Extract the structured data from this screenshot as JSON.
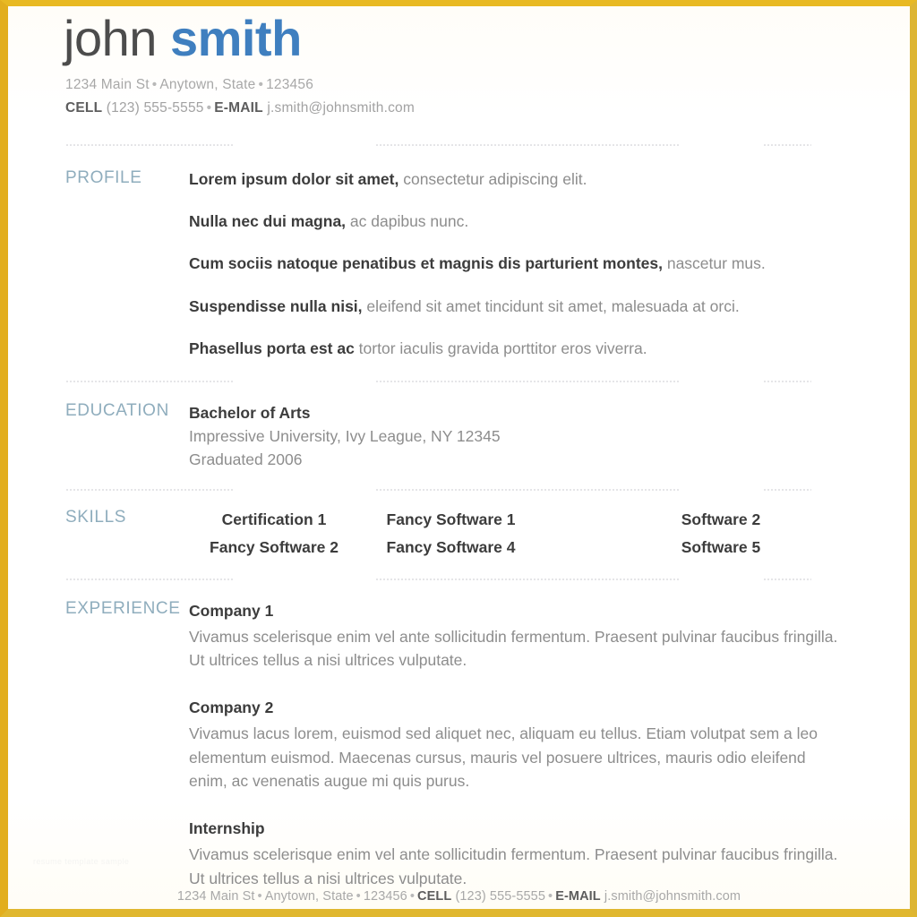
{
  "colors": {
    "accent_blue": "#3f7fbf",
    "section_label": "#8fadbd",
    "body_text": "#8d8d8d",
    "strong_text": "#3c3c3c",
    "page_border_gold": "#e8b923"
  },
  "header": {
    "first_name": "john",
    "last_name": "smith",
    "address": "1234 Main St",
    "city_state": "Anytown, State",
    "zip": "123456",
    "cell_label": "CELL",
    "cell_value": "(123) 555-5555",
    "email_label": "E-MAIL",
    "email_value": "j.smith@johnsmith.com",
    "separator": "•"
  },
  "sections": {
    "profile": {
      "label": "PROFILE",
      "items": [
        {
          "lead": "Lorem ipsum dolor sit amet,",
          "rest": " consectetur adipiscing elit."
        },
        {
          "lead": "Nulla nec dui magna,",
          "rest": " ac dapibus nunc."
        },
        {
          "lead": "Cum sociis natoque penatibus et magnis dis parturient montes,",
          "rest": " nascetur mus."
        },
        {
          "lead": "Suspendisse nulla nisi,",
          "rest": " eleifend sit amet tincidunt sit amet, malesuada at orci."
        },
        {
          "lead": "Phasellus porta est ac",
          "rest": " tortor iaculis gravida porttitor eros viverra."
        }
      ]
    },
    "education": {
      "label": "EDUCATION",
      "degree": "Bachelor of Arts",
      "institution": "Impressive University, Ivy League, NY 12345",
      "graduated": "Graduated 2006"
    },
    "skills": {
      "label": "SKILLS",
      "rows": [
        [
          "Certification 1",
          "Fancy Software 1",
          "Software 2"
        ],
        [
          "Fancy Software 2",
          "Fancy Software 4",
          "Software 5"
        ]
      ]
    },
    "experience": {
      "label": "EXPERIENCE",
      "jobs": [
        {
          "title": "Company 1",
          "description": "Vivamus scelerisque enim vel ante sollicitudin fermentum. Praesent pulvinar faucibus fringilla. Ut ultrices tellus a nisi ultrices vulputate."
        },
        {
          "title": "Company 2",
          "description": "Vivamus lacus lorem, euismod sed aliquet nec, aliquam eu tellus. Etiam volutpat sem a leo elementum euismod. Maecenas cursus, mauris vel posuere ultrices, mauris odio eleifend enim, ac venenatis augue mi quis purus."
        },
        {
          "title": "Internship",
          "description": "Vivamus scelerisque enim vel ante sollicitudin fermentum. Praesent pulvinar faucibus fringilla. Ut ultrices tellus a nisi ultrices vulputate."
        }
      ]
    }
  },
  "watermark": {
    "text": "resume template sample"
  },
  "footer": {
    "address": "1234 Main St",
    "city_state": "Anytown, State",
    "zip": "123456",
    "cell_label": "CELL",
    "cell_value": "(123) 555-5555",
    "email_label": "E-MAIL",
    "email_value": "j.smith@johnsmith.com",
    "separator": "•"
  }
}
